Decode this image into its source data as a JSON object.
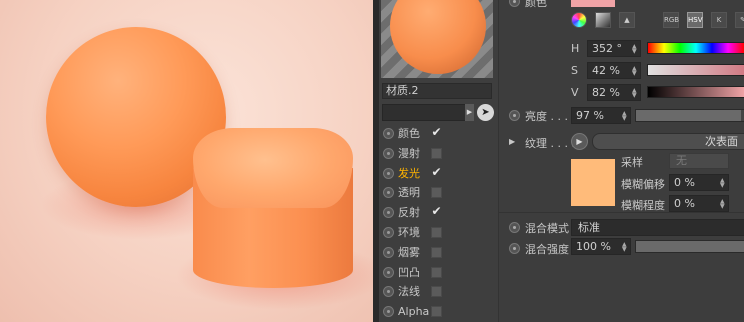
{
  "material": {
    "name": "材质.2",
    "channels": [
      {
        "label": "颜色",
        "checked": true,
        "active": false
      },
      {
        "label": "漫射",
        "checked": false,
        "active": false
      },
      {
        "label": "发光",
        "checked": true,
        "active": true
      },
      {
        "label": "透明",
        "checked": false,
        "active": false
      },
      {
        "label": "反射",
        "checked": true,
        "active": false
      },
      {
        "label": "环境",
        "checked": false,
        "active": false
      },
      {
        "label": "烟雾",
        "checked": false,
        "active": false
      },
      {
        "label": "凹凸",
        "checked": false,
        "active": false
      },
      {
        "label": "法线",
        "checked": false,
        "active": false
      },
      {
        "label": "Alpha",
        "checked": false,
        "active": false
      }
    ]
  },
  "attributes": {
    "color_label": "颜色",
    "color_swatch": "#f0a3a6",
    "modes": [
      "RGB",
      "HSV",
      "K"
    ],
    "selected_mode": "HSV",
    "h_label": "H",
    "h_value": "352 °",
    "s_label": "S",
    "s_value": "42 %",
    "v_label": "V",
    "v_value": "82 %",
    "brightness_label": "亮度 . . . . .",
    "brightness_value": "97 %",
    "brightness_level": 0.97,
    "texture_label": "纹理 . . . . .",
    "texture_bar_text": "次表面",
    "texture_swatch": "#ffbb7a",
    "sampling_label": "采样",
    "sampling_value": "无",
    "blur_offset_label": "模糊偏移",
    "blur_offset_value": "0 %",
    "blur_scale_label": "模糊程度",
    "blur_scale_value": "0 %",
    "blend_mode_label": "混合模式",
    "blend_mode_value": "标准",
    "blend_strength_label": "混合强度",
    "blend_strength_value": "100 %",
    "blend_strength_level": 1.0
  },
  "icons": [
    "color-wheel-icon",
    "spectrum-icon",
    "image-icon",
    "eyedropper-icon"
  ]
}
